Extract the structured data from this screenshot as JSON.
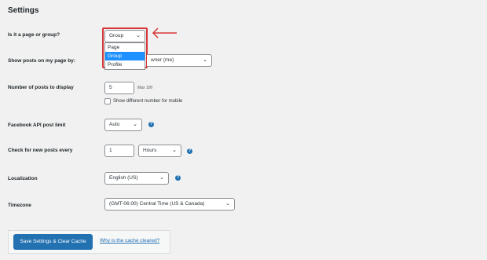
{
  "title": "Settings",
  "fields": {
    "type": {
      "label": "Is it a page or group?",
      "value": "Group",
      "options": [
        "Page",
        "Group",
        "Profile"
      ],
      "selected_index": 1
    },
    "show_posts": {
      "label": "Show posts on my page by:",
      "visible_value": "wner (me)"
    },
    "num_posts": {
      "label": "Number of posts to display",
      "value": "5",
      "hint": "Max 100",
      "mobile_checkbox_label": "Show different number for mobile"
    },
    "api_limit": {
      "label": "Facebook API post limit",
      "value": "Auto"
    },
    "check_posts": {
      "label": "Check for new posts every",
      "value": "1",
      "unit": "Hours"
    },
    "localization": {
      "label": "Localization",
      "value": "English (US)"
    },
    "timezone": {
      "label": "Timezone",
      "value": "(GMT-06:00) Central Time (US & Canada)"
    }
  },
  "footer": {
    "save_button": "Save Settings & Clear Cache",
    "why_link": "Why is the cache cleared?"
  },
  "colors": {
    "accent": "#2271b1",
    "highlight": "#d63638",
    "selected_option": "#1e90ff"
  }
}
